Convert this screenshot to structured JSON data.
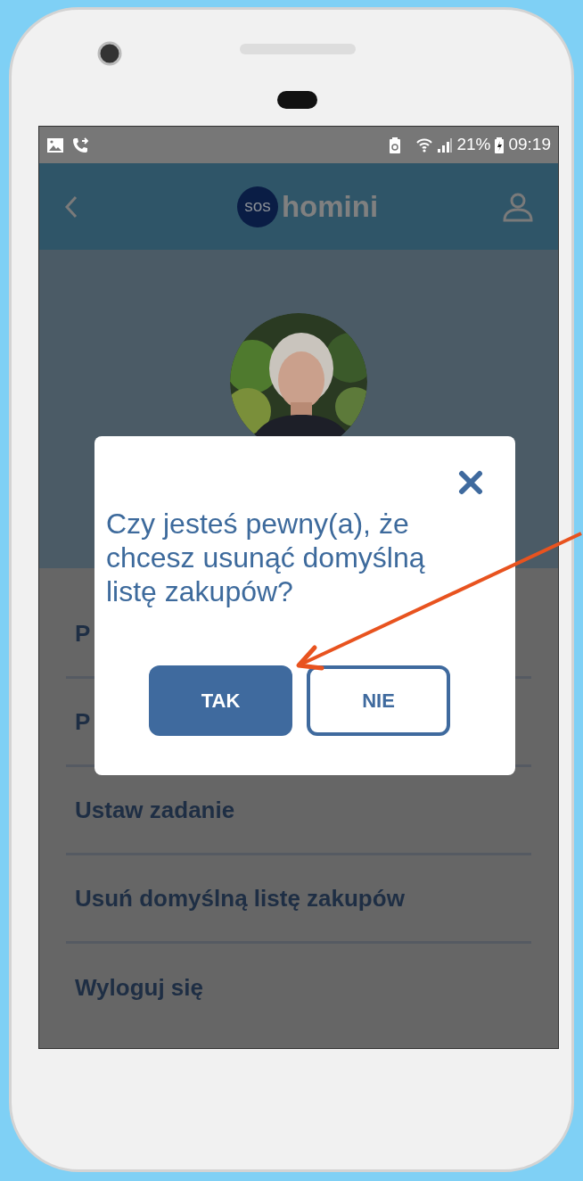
{
  "status_bar": {
    "battery": "21%",
    "time": "09:19"
  },
  "header": {
    "logo_badge": "sos",
    "logo_name": "homini"
  },
  "menu": [
    {
      "label": "P"
    },
    {
      "label": "P"
    },
    {
      "label": "Ustaw zadanie"
    },
    {
      "label": "Usuń domyślną listę zakupów"
    },
    {
      "label": "Wyloguj się"
    }
  ],
  "dialog": {
    "question": "Czy jesteś pewny(a), że chcesz usunąć domyślną listę zakupów?",
    "buttons": [
      {
        "label": "TAK",
        "kind": "primary"
      },
      {
        "label": "NIE",
        "kind": "outline"
      }
    ]
  }
}
